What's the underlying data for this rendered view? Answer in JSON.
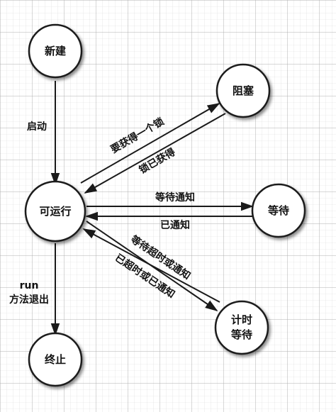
{
  "diagram": {
    "nodes": {
      "new": "新建",
      "blocked": "阻塞",
      "runnable": "可运行",
      "waiting": "等待",
      "timed_waiting_line1": "计时",
      "timed_waiting_line2": "等待",
      "terminated": "终止"
    },
    "edges": {
      "start": "启动",
      "acquire_lock": "要获得一个锁",
      "lock_acquired": "锁已获得",
      "wait_notify": "等待通知",
      "notified": "已通知",
      "wait_timeout_or_notify": "等待超时或通知",
      "timed_out_or_notified": "已超时或已通知",
      "run_method_exit_line1": "run",
      "run_method_exit_line2": "方法退出"
    }
  },
  "colors": {
    "grid_minor": "#d9d9d9",
    "grid_major": "#b0b0b0",
    "node_fill": "#ffffff",
    "node_stroke": "#1a1a1a",
    "arrow": "#1a1a1a",
    "text": "#111111"
  }
}
